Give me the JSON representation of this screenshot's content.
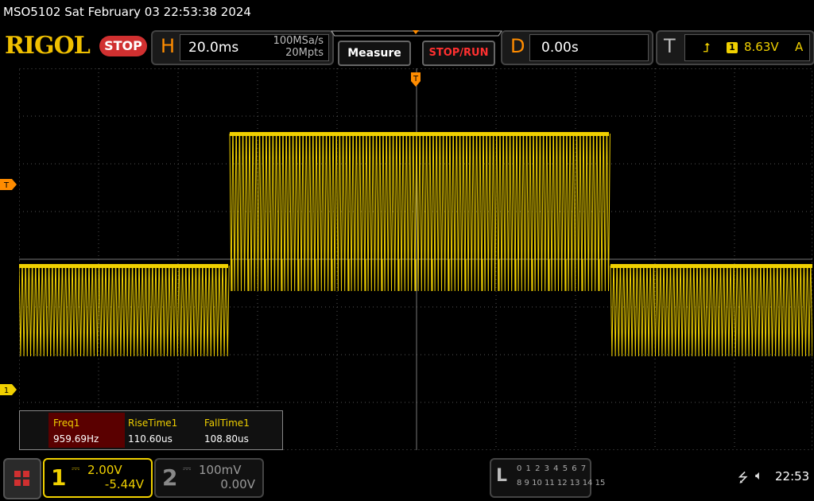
{
  "status_line": "MSO5102  Sat February 03 22:53:38 2024",
  "logo": "RIGOL",
  "run_state": "STOP",
  "horizontal": {
    "letter": "H",
    "timebase": "20.0ms",
    "sample_rate": "100MSa/s",
    "memory_depth": "20Mpts"
  },
  "buttons": {
    "measure": "Measure",
    "stop_run": "STOP/RUN"
  },
  "delay": {
    "letter": "D",
    "value": "0.00s"
  },
  "trigger": {
    "letter": "T",
    "source": "1",
    "level": "8.63V",
    "mode": "A",
    "slope_icon": "rising-edge-icon"
  },
  "markers": {
    "trigger_top": "T",
    "trigger_level": "T",
    "ch1_ground": "1"
  },
  "measurements": [
    {
      "label": "Freq1",
      "value": "959.69Hz"
    },
    {
      "label": "RiseTime1",
      "value": "110.60us"
    },
    {
      "label": "FallTime1",
      "value": "108.80us"
    }
  ],
  "channel1": {
    "number": "1",
    "scale": "2.00V",
    "offset": "-5.44V"
  },
  "channel2": {
    "number": "2",
    "scale": "100mV",
    "offset": "0.00V"
  },
  "logic": {
    "letter": "L",
    "row1": "0 1 2 3  4 5 6 7",
    "row2": "8 9 10 11 12 13 14 15"
  },
  "clock": "22:53",
  "colors": {
    "ch1": "#f0d000",
    "accent": "#ff8c00",
    "stop": "#d03030",
    "grid": "#555555"
  }
}
